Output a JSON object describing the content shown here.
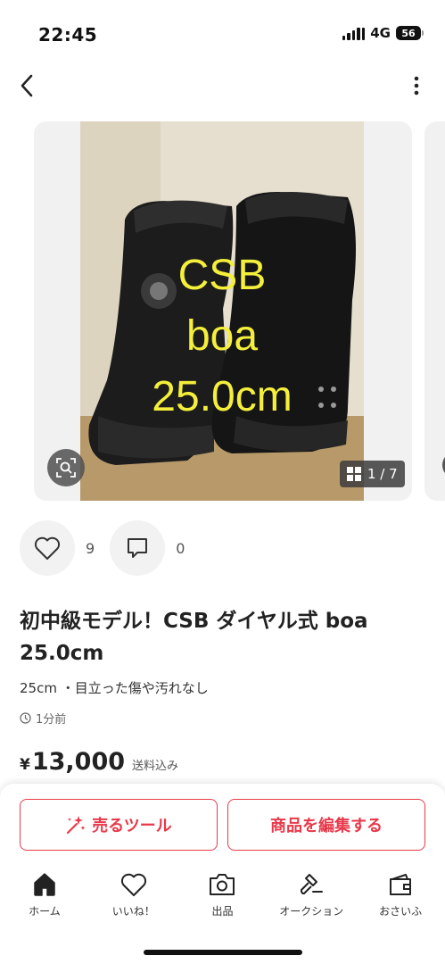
{
  "status_bar": {
    "time": "22:45",
    "network": "4G",
    "battery": "56"
  },
  "gallery": {
    "photo_text": [
      "CSB",
      "boa",
      "25.0cm"
    ],
    "counter": "1 / 7",
    "photo_text_color": "#f4ef3a"
  },
  "actions": {
    "likes": "9",
    "comments": "0"
  },
  "item": {
    "title": "初中級モデル！CSB ダイヤル式 boa 25.0cm",
    "description": "25cm ・目立った傷や汚れなし",
    "posted": "1分前",
    "currency": "¥",
    "price": "13,000",
    "shipping": "送料込み"
  },
  "buttons": {
    "sell_tool": "売るツール",
    "edit_item": "商品を編集する"
  },
  "tabs": [
    {
      "label": "ホーム",
      "icon": "home-icon"
    },
    {
      "label": "いいね！",
      "icon": "heart-icon"
    },
    {
      "label": "出品",
      "icon": "camera-icon"
    },
    {
      "label": "オークション",
      "icon": "gavel-icon"
    },
    {
      "label": "おさいふ",
      "icon": "wallet-icon"
    }
  ],
  "colors": {
    "accent": "#e8394a",
    "text": "#222222"
  }
}
